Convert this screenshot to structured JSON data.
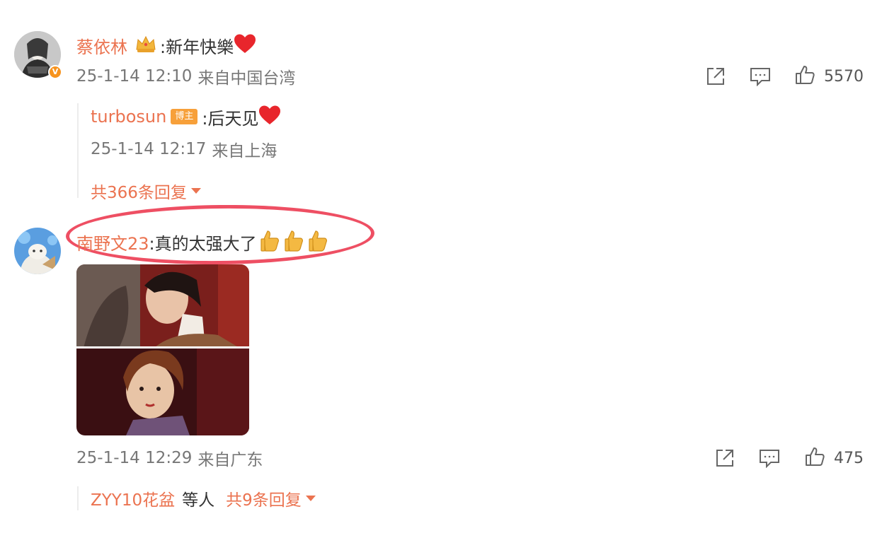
{
  "comment1": {
    "username": "蔡依林",
    "text": ":新年快樂",
    "time": "25-1-14 12:10",
    "location": "来自中国台湾",
    "likes": "5570",
    "avatar_icon": "avatar-icon",
    "crown_icon": "crown-icon"
  },
  "reply1": {
    "username": "turbosun",
    "badge": "博主",
    "text": ":后天见",
    "time": "25-1-14 12:17",
    "location": "来自上海"
  },
  "more_replies_1": "共366条回复",
  "comment2": {
    "username": "南野文23",
    "text": ":真的太强大了",
    "time": "25-1-14 12:29",
    "location": "来自广东",
    "likes": "475",
    "thumb_icon": "thumbs-up-emoji"
  },
  "comment2_replies": {
    "users": "ZYY10花盆",
    "suffix": "等人",
    "count": "共9条回复"
  },
  "colors": {
    "accent": "#eb7350",
    "highlight": "#ee4f63",
    "heart": "#e8262c",
    "badge": "#f7a03a"
  }
}
